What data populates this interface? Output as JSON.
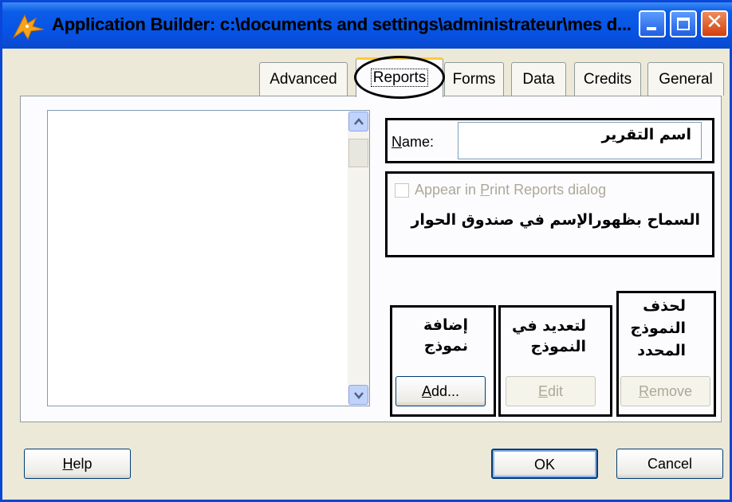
{
  "window": {
    "title": "Application Builder: c:\\documents and settings\\administrateur\\mes d...",
    "controls": [
      "minimize-icon",
      "maximize-icon",
      "close-icon"
    ],
    "close_glyph": "✕"
  },
  "tabs": [
    {
      "label": "Advanced"
    },
    {
      "label": "Reports",
      "selected": true
    },
    {
      "label": "Forms"
    },
    {
      "label": "Data"
    },
    {
      "label": "Credits"
    },
    {
      "label": "General"
    }
  ],
  "reports_panel": {
    "name_label_key": "N",
    "name_label_rest": "ame:",
    "name_value": "اسم التقرير",
    "appear_label_pre": "Appear in ",
    "appear_label_key": "P",
    "appear_label_post": "rint Reports dialog",
    "appear_checked": false,
    "appear_note": "السماح بظهورالإسم في صندوق الحوار",
    "add_note": "إضافة نموذج",
    "edit_note": "لتعديد في النموذج",
    "remove_note": "لحذف النموذج المحدد",
    "add_key": "A",
    "add_rest": "dd...",
    "edit_key": "E",
    "edit_rest": "dit",
    "remove_key": "R",
    "remove_rest": "emove"
  },
  "footer": {
    "help_key": "H",
    "help_rest": "elp",
    "ok_label": "OK",
    "cancel_label": "Cancel"
  },
  "colors": {
    "titlebar": "#0654e6",
    "face": "#ece9d8",
    "selected_tab_accent": "#ffc83c",
    "disabled_text": "#aca899"
  }
}
